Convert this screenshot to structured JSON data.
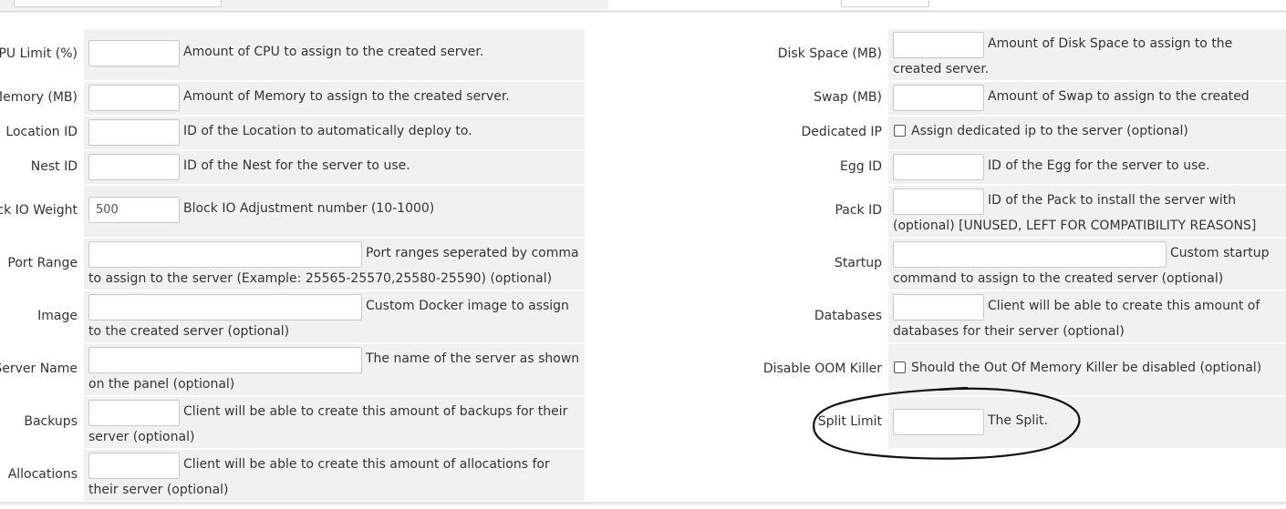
{
  "left": [
    {
      "label": "CPU Limit (%)",
      "input": "",
      "desc": "Amount of CPU to assign to the created server."
    },
    {
      "label": "Memory (MB)",
      "input": "",
      "desc": "Amount of Memory to assign to the created server."
    },
    {
      "label": "Location ID",
      "input": "",
      "desc": "ID of the Location to automatically deploy to."
    },
    {
      "label": "Nest ID",
      "input": "",
      "desc": "ID of the Nest for the server to use."
    },
    {
      "label": "Block IO Weight",
      "input": "500",
      "desc": "Block IO Adjustment number (10-1000)"
    },
    {
      "label": "Port Range",
      "input": "",
      "desc": "Port ranges seperated by comma to assign to the server (Example: 25565-25570,25580-25590) (optional)"
    },
    {
      "label": "Image",
      "input": "",
      "desc": "Custom Docker image to assign to the created server (optional)"
    },
    {
      "label": "Server Name",
      "input": "",
      "desc": "The name of the server as shown on the panel (optional)"
    },
    {
      "label": "Backups",
      "input": "",
      "desc": "Client will be able to create this amount of backups for their server (optional)"
    },
    {
      "label": "Allocations",
      "input": "",
      "desc": "Client will be able to create this amount of allocations for their server (optional)"
    }
  ],
  "right": [
    {
      "label": "Disk Space (MB)",
      "input": "",
      "desc": "Amount of Disk Space to assign to the created server."
    },
    {
      "label": "Swap (MB)",
      "input": "",
      "desc": "Amount of Swap to assign to the created server."
    },
    {
      "label": "Dedicated IP",
      "checkbox": true,
      "desc": "Assign dedicated ip to the server (optional)"
    },
    {
      "label": "Egg ID",
      "input": "",
      "desc": "ID of the Egg for the server to use."
    },
    {
      "label": "Pack ID",
      "input": "",
      "desc": "ID of the Pack to install the server with (optional) [UNUSED, LEFT FOR COMPATIBILITY REASONS]"
    },
    {
      "label": "Startup",
      "input": "",
      "desc": "Custom startup command to assign to the created server (optional)"
    },
    {
      "label": "Databases",
      "input": "",
      "desc": "Client will be able to create this amount of databases for their server (optional)"
    },
    {
      "label": "Disable OOM Killer",
      "checkbox": true,
      "desc": "Should the Out Of Memory Killer be disabled (optional)"
    },
    {
      "label": "Split Limit",
      "input": "",
      "desc": "The Split."
    }
  ],
  "annotation": {
    "shape": "hand-drawn-ellipse",
    "color": "#111111",
    "target": "Split Limit"
  }
}
